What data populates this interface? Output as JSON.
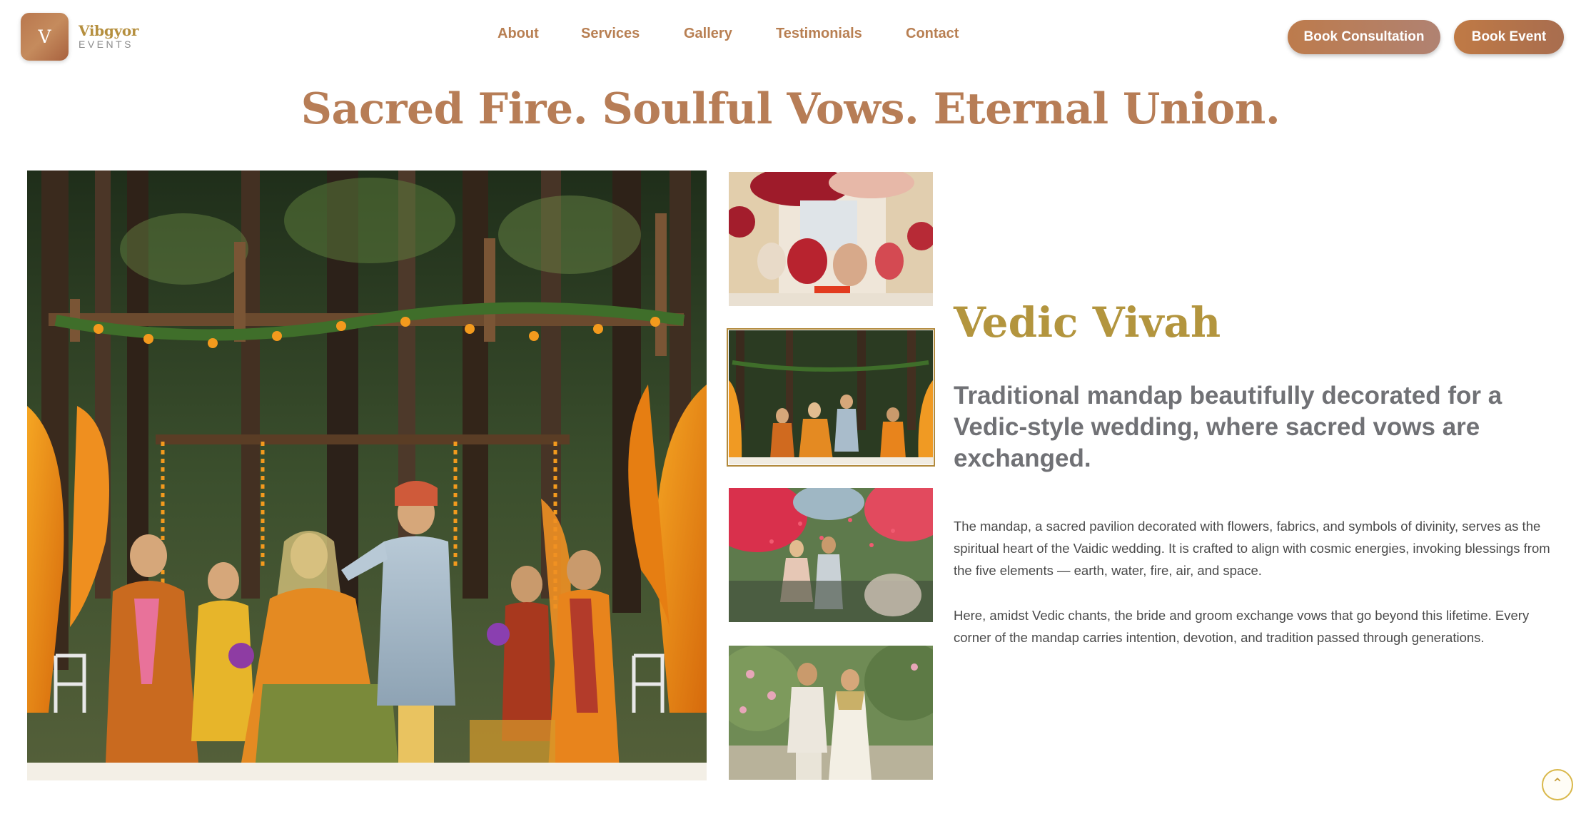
{
  "brand": {
    "logo_letter": "V",
    "name": "Vibgyor",
    "tagline": "EVENTS"
  },
  "nav": {
    "items": [
      {
        "label": "About"
      },
      {
        "label": "Services"
      },
      {
        "label": "Gallery"
      },
      {
        "label": "Testimonials"
      },
      {
        "label": "Contact"
      }
    ]
  },
  "actions": {
    "consult_label": "Book Consultation",
    "event_label": "Book Event"
  },
  "hero": {
    "headline": "Sacred Fire. Soulful Vows. Eternal Union."
  },
  "gallery": {
    "active_index": 1,
    "thumbnails": [
      {
        "icon": "mandap-indoor-ceremony-photo"
      },
      {
        "icon": "forest-mandap-ceremony-photo"
      },
      {
        "icon": "petal-shower-photo"
      },
      {
        "icon": "couple-portrait-photo"
      }
    ]
  },
  "content": {
    "title": "Vedic Vivah",
    "subtitle": "Traditional mandap beautifully decorated for a Vedic-style wedding, where sacred vows are exchanged.",
    "paragraph1": "The mandap, a sacred pavilion decorated with flowers, fabrics, and symbols of divinity, serves as the spiritual heart of the Vaidic wedding. It is crafted to align with cosmic energies, invoking blessings from the five elements — earth, water, fire, air, and space.",
    "paragraph2": "Here, amidst Vedic chants, the bride and groom exchange vows that go beyond this lifetime. Every corner of the mandap carries intention, devotion, and tradition passed through generations."
  },
  "scroll_top": {
    "icon": "chevron-up-icon",
    "glyph": "⌃"
  },
  "colors": {
    "accent_copper": "#b87f52",
    "title_gold": "#b3953e",
    "subtitle_gray": "#707175",
    "headline": "#b77d56"
  }
}
